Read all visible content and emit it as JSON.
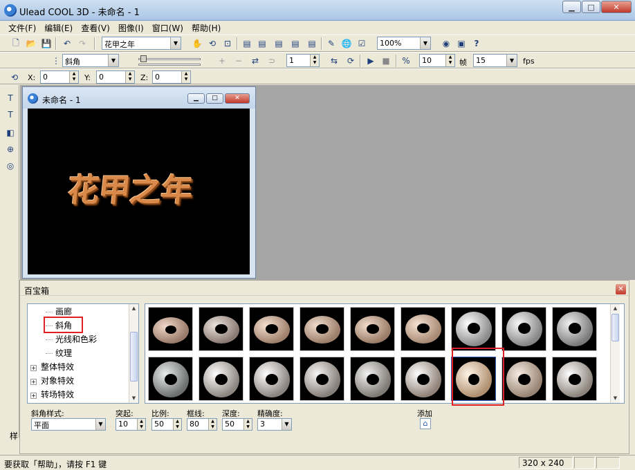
{
  "window": {
    "title": "Ulead COOL 3D - 未命名 - 1",
    "minimize": "▁",
    "maximize": "□",
    "close": "✕"
  },
  "menu": [
    "文件(F)",
    "编辑(E)",
    "查看(V)",
    "图像(I)",
    "窗口(W)",
    "帮助(H)"
  ],
  "toolbar1": {
    "object_select": "花甲之年",
    "zoom": "100%",
    "help_icon": "?"
  },
  "toolbar2": {
    "style_select": "斜角",
    "frame_value": "1",
    "frames_value": "10",
    "frames_label": "帧",
    "fps_value": "15",
    "fps_label": "fps"
  },
  "toolbar3": {
    "x_label": "X:",
    "x_value": "0",
    "y_label": "Y:",
    "y_value": "0",
    "z_label": "Z:",
    "z_value": "0"
  },
  "child_window": {
    "title": "未命名 - 1",
    "close": "✕",
    "art_text": "花甲之年"
  },
  "palette": {
    "title": "百宝箱",
    "close": "✕",
    "tree": [
      {
        "label": "画廊",
        "kind": "leaf"
      },
      {
        "label": "斜角",
        "kind": "leaf",
        "highlighted": true
      },
      {
        "label": "光线和色彩",
        "kind": "leaf"
      },
      {
        "label": "纹理",
        "kind": "leaf"
      },
      {
        "label": "整体特效",
        "kind": "group"
      },
      {
        "label": "对象特效",
        "kind": "group"
      },
      {
        "label": "转场特效",
        "kind": "group"
      }
    ],
    "expand_symbol": "+",
    "options": {
      "bevel_style_label": "斜角样式:",
      "bevel_style_value": "平面",
      "protrude_label": "突起:",
      "protrude_value": "10",
      "scale_label": "比例:",
      "scale_value": "50",
      "border_label": "框线:",
      "border_value": "80",
      "depth_label": "深度:",
      "depth_value": "50",
      "precision_label": "精确度:",
      "precision_value": "3",
      "add_label": "添加"
    }
  },
  "status": {
    "text": "要获取「帮助」，请按 F1 键",
    "size": "320 x 240",
    "under_label": "样"
  },
  "colors": {
    "highlight": "#e02020",
    "workspace": "#a6a6a6",
    "art": "#d98a4a"
  }
}
